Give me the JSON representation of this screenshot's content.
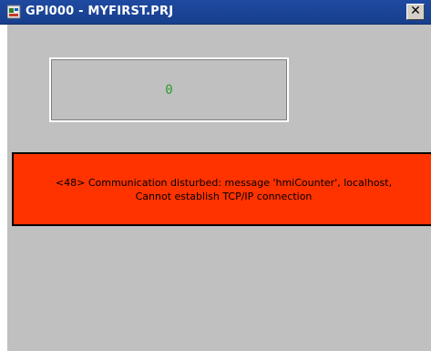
{
  "window": {
    "title": "GPI000 - MYFIRST.PRJ",
    "close_label": "✕",
    "icon": "app-icon"
  },
  "counter": {
    "value": "0"
  },
  "error": {
    "line1": "<48> Communication disturbed: message 'hmiCounter', localhost,",
    "line2": "Cannot establish TCP/IP connection"
  },
  "colors": {
    "titlebar": "#1f4aa1",
    "client_bg": "#c0c0c0",
    "error_bg": "#ff3300",
    "counter_text": "#2a9d2a"
  }
}
